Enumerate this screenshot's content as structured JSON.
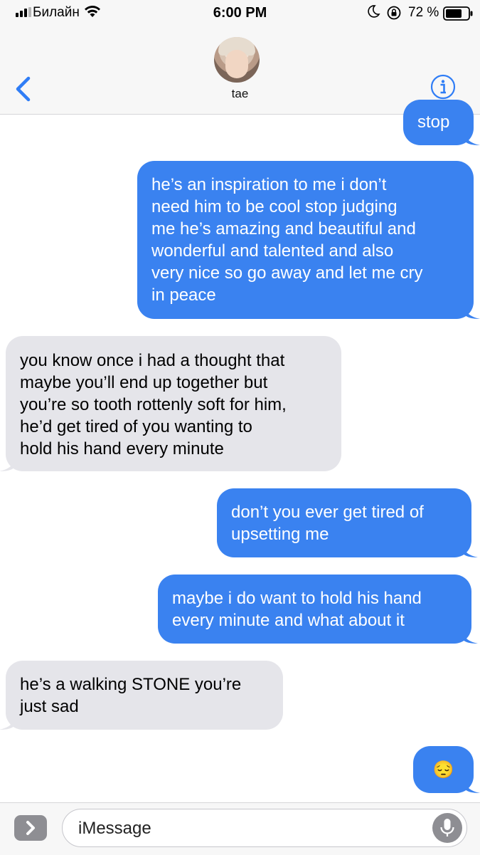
{
  "status_bar": {
    "carrier": "Билайн",
    "time": "6:00 PM",
    "battery_percent": "72 %"
  },
  "header": {
    "contact_name": "tae",
    "back_icon": "chevron-left-icon",
    "info_icon": "info-icon"
  },
  "messages": [
    {
      "direction": "sent",
      "lines": [
        "stop"
      ]
    },
    {
      "direction": "sent",
      "lines": [
        "he’s an inspiration to me i don’t",
        "need him to be cool stop judging",
        "me he’s amazing and beautiful and",
        "wonderful and talented and also",
        "very nice so go away and let me cry",
        "in peace"
      ]
    },
    {
      "direction": "received",
      "lines": [
        "you know once i had a thought that",
        "maybe you’ll end up together but",
        "you’re so tooth rottenly soft for him,",
        "he’d get tired of you wanting to",
        "hold his hand every minute"
      ]
    },
    {
      "direction": "sent",
      "lines": [
        "don’t you ever get tired of",
        "upsetting me"
      ]
    },
    {
      "direction": "sent",
      "lines": [
        "maybe i do want to hold his hand",
        "every minute and what about it"
      ]
    },
    {
      "direction": "received",
      "lines": [
        "he’s a walking STONE you’re",
        "just sad"
      ]
    },
    {
      "direction": "sent",
      "lines": [
        "😔"
      ]
    }
  ],
  "input_bar": {
    "placeholder": "iMessage",
    "apps_icon": "chevron-right-icon",
    "mic_icon": "microphone-icon"
  },
  "colors": {
    "sent_bubble": "#3a82f0",
    "received_bubble": "#e5e5ea",
    "accent": "#2f7df6"
  }
}
